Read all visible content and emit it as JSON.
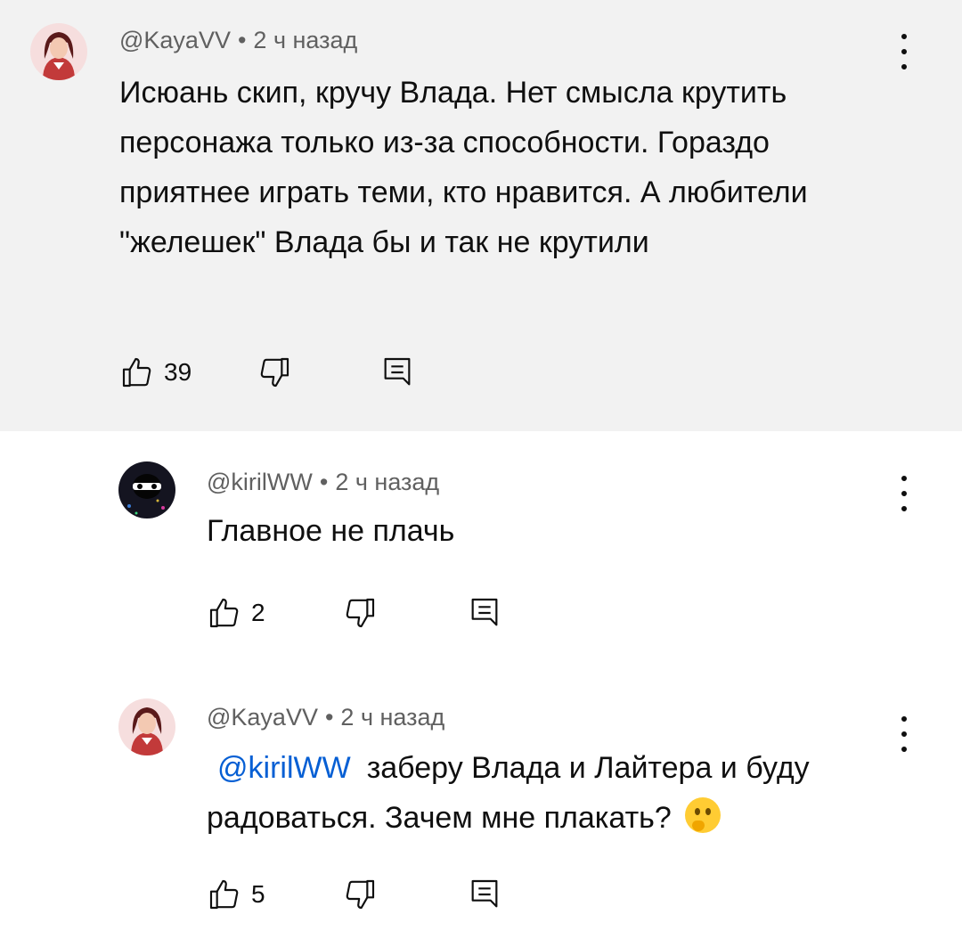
{
  "comments": [
    {
      "author": "@KayaVV",
      "separator": "•",
      "time": "2 ч назад",
      "text": "Исюань скип, кручу Влада. Нет смысла крутить персонажа только из-за способности. Гораздо приятнее играть теми, кто нравится. А любители \"желешек\" Влада бы и так не крутили",
      "likes": "39",
      "highlighted": true
    },
    {
      "author": "@kirilWW",
      "separator": "•",
      "time": "2 ч назад",
      "text": "Главное не плачь",
      "likes": "2"
    },
    {
      "author": "@KayaVV",
      "separator": "•",
      "time": "2 ч назад",
      "mention": "@kirilWW",
      "text": "заберу Влада и Лайтера и буду радоваться. Зачем мне плакать?",
      "emoji": "thinking-face",
      "likes": "5"
    }
  ],
  "colors": {
    "highlight_bg": "#f2f2f2",
    "meta_text": "#606060",
    "mention": "#065fd4",
    "text": "#0f0f0f"
  },
  "icons": [
    "like-icon",
    "dislike-icon",
    "reply-icon",
    "more-vert-icon",
    "thinking-face-emoji"
  ]
}
